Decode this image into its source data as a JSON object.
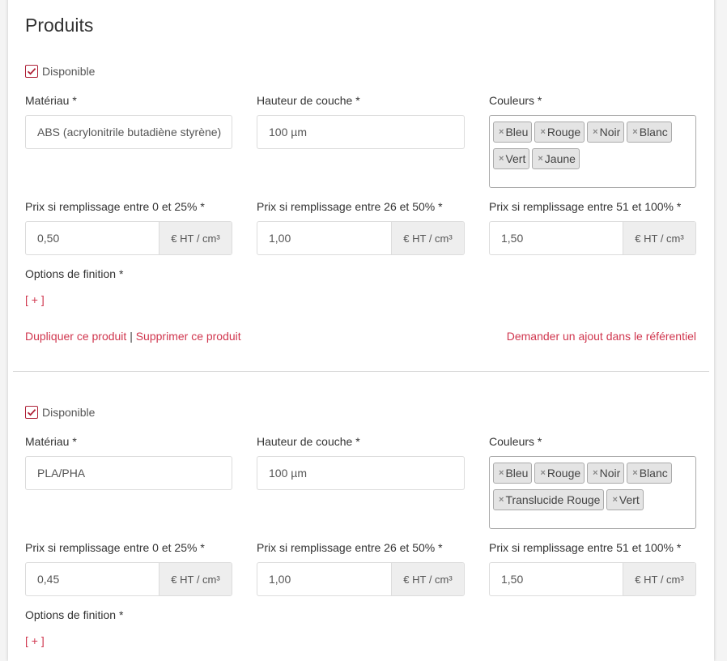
{
  "page": {
    "title": "Produits"
  },
  "labels": {
    "available": "Disponible",
    "material": "Matériau *",
    "layer_height": "Hauteur de couche *",
    "colors": "Couleurs *",
    "price_0_25": "Prix si remplissage entre 0 et 25% *",
    "price_26_50": "Prix si remplissage entre 26 et 50% *",
    "price_51_100": "Prix si remplissage entre 51 et 100% *",
    "unit": "€ HT / cm³",
    "finishing_options": "Options de finition *",
    "add_option": "[ + ]",
    "duplicate": "Dupliquer ce produit",
    "separator": "|",
    "delete": "Supprimer ce produit",
    "request_add": "Demander un ajout dans le référentiel"
  },
  "products": [
    {
      "available": true,
      "material": "ABS (acrylonitrile butadiène styrène)",
      "layer_height": "100 µm",
      "colors": [
        "Bleu",
        "Rouge",
        "Noir",
        "Blanc",
        "Vert",
        "Jaune"
      ],
      "price_0_25": "0,50",
      "price_26_50": "1,00",
      "price_51_100": "1,50"
    },
    {
      "available": true,
      "material": "PLA/PHA",
      "layer_height": "100 µm",
      "colors": [
        "Bleu",
        "Rouge",
        "Noir",
        "Blanc",
        "Translucide Rouge",
        "Vert"
      ],
      "price_0_25": "0,45",
      "price_26_50": "1,00",
      "price_51_100": "1,50"
    }
  ],
  "colors": {
    "accent": "#d0364e",
    "checkbox": "#b0243a"
  }
}
